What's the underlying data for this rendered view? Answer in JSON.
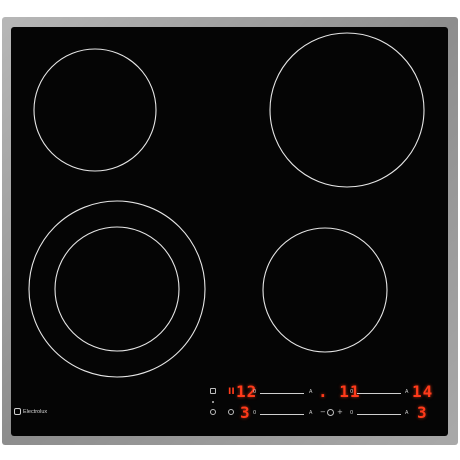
{
  "brand": {
    "name": "Electrolux"
  },
  "displays": {
    "top_left": "12",
    "top_middle": ". 11",
    "top_right": "14",
    "bottom_left": "3",
    "bottom_right": "3"
  },
  "controls": {
    "pause_symbol": "II",
    "timer_minus": "−",
    "timer_plus": "+",
    "slider_start_mark": "0",
    "slider_end_mark": "A"
  },
  "colors": {
    "glass": "#050505",
    "frame": "#8f8f8f",
    "display": "#ff3a1a",
    "ring": "#e6e6e6"
  },
  "icons": [
    "electrolux-logo-icon",
    "lock-icon",
    "power-icon",
    "timer-icon",
    "hob-sync-icon"
  ]
}
